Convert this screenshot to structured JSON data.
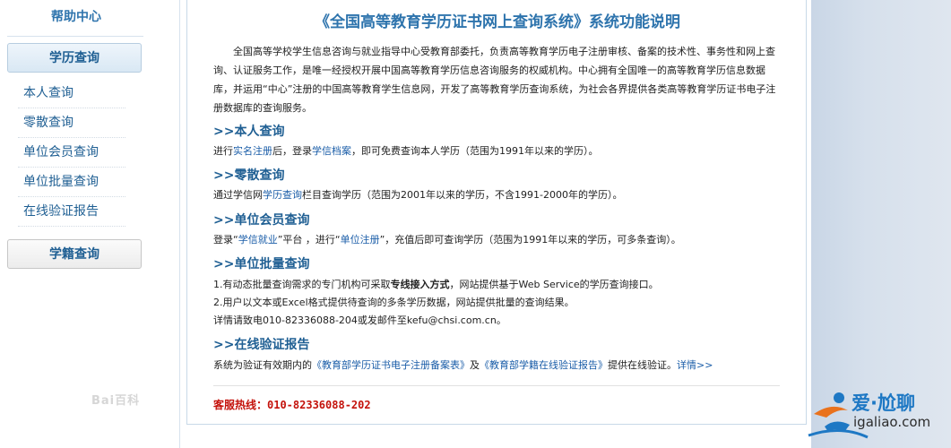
{
  "sidebar": {
    "help_title": "帮助中心",
    "primary_button": "学历查询",
    "items": [
      "本人查询",
      "零散查询",
      "单位会员查询",
      "单位批量查询",
      "在线验证报告"
    ],
    "secondary_button": "学籍查询"
  },
  "main": {
    "title": "《全国高等教育学历证书网上查询系统》系统功能说明",
    "intro": "全国高等学校学生信息咨询与就业指导中心受教育部委托，负责高等教育学历电子注册审核、备案的技术性、事务性和网上查询、认证服务工作，是唯一经授权开展中国高等教育学历信息咨询服务的权威机构。中心拥有全国唯一的高等教育学历信息数据库，并运用“中心”注册的中国高等教育学生信息网，开发了高等教育学历查询系统，为社会各界提供各类高等教育学历证书电子注册数据库的查询服务。",
    "sections": {
      "self": {
        "heading": ">>本人查询",
        "t1": "进行",
        "l1": "实名注册",
        "t2": "后，登录",
        "l2": "学信档案",
        "t3": "，即可免费查询本人学历（范围为1991年以来的学历）。"
      },
      "scattered": {
        "heading": ">>零散查询",
        "t1": "通过学信网",
        "l1": "学历查询",
        "t2": "栏目查询学历（范围为2001年以来的学历，不含1991-2000年的学历）。"
      },
      "member": {
        "heading": ">>单位会员查询",
        "t1": "登录“",
        "l1": "学信就业",
        "t2": "”平台 ，进行“",
        "l2": "单位注册",
        "t3": "”，充值后即可查询学历（范围为1991年以来的学历，可多条查询）。"
      },
      "batch": {
        "heading": ">>单位批量查询",
        "line1_a": "1.有动态批量查询需求的专门机构可采取",
        "line1_b": "专线接入方式",
        "line1_c": "，网站提供基于Web Service的学历查询接口。",
        "line2": "2.用户以文本或Excel格式提供待查询的多条学历数据，网站提供批量的查询结果。",
        "line3": "详情请致电010-82336088-204或发邮件至kefu@chsi.com.cn。"
      },
      "verify": {
        "heading": ">>在线验证报告",
        "t1": "系统为验证有效期内的",
        "l1": "《教育部学历证书电子注册备案表》",
        "t2": "及",
        "l2": "《教育部学籍在线验证报告》",
        "t3": "提供在线验证。",
        "l3": "详情>>"
      }
    },
    "hotline": "客服热线：010-82336088-202"
  },
  "watermarks": {
    "baidu": "Bai百科",
    "site_name": "爱·尬聊",
    "site_url": "igaliao.com"
  }
}
